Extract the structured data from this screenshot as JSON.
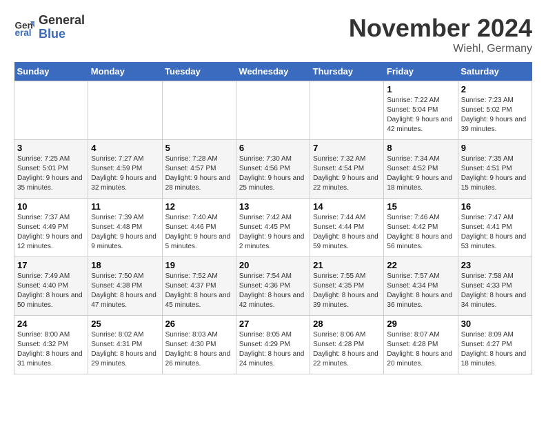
{
  "logo": {
    "general": "General",
    "blue": "Blue"
  },
  "title": {
    "month": "November 2024",
    "location": "Wiehl, Germany"
  },
  "days_of_week": [
    "Sunday",
    "Monday",
    "Tuesday",
    "Wednesday",
    "Thursday",
    "Friday",
    "Saturday"
  ],
  "weeks": [
    [
      {
        "day": "",
        "info": ""
      },
      {
        "day": "",
        "info": ""
      },
      {
        "day": "",
        "info": ""
      },
      {
        "day": "",
        "info": ""
      },
      {
        "day": "",
        "info": ""
      },
      {
        "day": "1",
        "info": "Sunrise: 7:22 AM\nSunset: 5:04 PM\nDaylight: 9 hours and 42 minutes."
      },
      {
        "day": "2",
        "info": "Sunrise: 7:23 AM\nSunset: 5:02 PM\nDaylight: 9 hours and 39 minutes."
      }
    ],
    [
      {
        "day": "3",
        "info": "Sunrise: 7:25 AM\nSunset: 5:01 PM\nDaylight: 9 hours and 35 minutes."
      },
      {
        "day": "4",
        "info": "Sunrise: 7:27 AM\nSunset: 4:59 PM\nDaylight: 9 hours and 32 minutes."
      },
      {
        "day": "5",
        "info": "Sunrise: 7:28 AM\nSunset: 4:57 PM\nDaylight: 9 hours and 28 minutes."
      },
      {
        "day": "6",
        "info": "Sunrise: 7:30 AM\nSunset: 4:56 PM\nDaylight: 9 hours and 25 minutes."
      },
      {
        "day": "7",
        "info": "Sunrise: 7:32 AM\nSunset: 4:54 PM\nDaylight: 9 hours and 22 minutes."
      },
      {
        "day": "8",
        "info": "Sunrise: 7:34 AM\nSunset: 4:52 PM\nDaylight: 9 hours and 18 minutes."
      },
      {
        "day": "9",
        "info": "Sunrise: 7:35 AM\nSunset: 4:51 PM\nDaylight: 9 hours and 15 minutes."
      }
    ],
    [
      {
        "day": "10",
        "info": "Sunrise: 7:37 AM\nSunset: 4:49 PM\nDaylight: 9 hours and 12 minutes."
      },
      {
        "day": "11",
        "info": "Sunrise: 7:39 AM\nSunset: 4:48 PM\nDaylight: 9 hours and 9 minutes."
      },
      {
        "day": "12",
        "info": "Sunrise: 7:40 AM\nSunset: 4:46 PM\nDaylight: 9 hours and 5 minutes."
      },
      {
        "day": "13",
        "info": "Sunrise: 7:42 AM\nSunset: 4:45 PM\nDaylight: 9 hours and 2 minutes."
      },
      {
        "day": "14",
        "info": "Sunrise: 7:44 AM\nSunset: 4:44 PM\nDaylight: 8 hours and 59 minutes."
      },
      {
        "day": "15",
        "info": "Sunrise: 7:46 AM\nSunset: 4:42 PM\nDaylight: 8 hours and 56 minutes."
      },
      {
        "day": "16",
        "info": "Sunrise: 7:47 AM\nSunset: 4:41 PM\nDaylight: 8 hours and 53 minutes."
      }
    ],
    [
      {
        "day": "17",
        "info": "Sunrise: 7:49 AM\nSunset: 4:40 PM\nDaylight: 8 hours and 50 minutes."
      },
      {
        "day": "18",
        "info": "Sunrise: 7:50 AM\nSunset: 4:38 PM\nDaylight: 8 hours and 47 minutes."
      },
      {
        "day": "19",
        "info": "Sunrise: 7:52 AM\nSunset: 4:37 PM\nDaylight: 8 hours and 45 minutes."
      },
      {
        "day": "20",
        "info": "Sunrise: 7:54 AM\nSunset: 4:36 PM\nDaylight: 8 hours and 42 minutes."
      },
      {
        "day": "21",
        "info": "Sunrise: 7:55 AM\nSunset: 4:35 PM\nDaylight: 8 hours and 39 minutes."
      },
      {
        "day": "22",
        "info": "Sunrise: 7:57 AM\nSunset: 4:34 PM\nDaylight: 8 hours and 36 minutes."
      },
      {
        "day": "23",
        "info": "Sunrise: 7:58 AM\nSunset: 4:33 PM\nDaylight: 8 hours and 34 minutes."
      }
    ],
    [
      {
        "day": "24",
        "info": "Sunrise: 8:00 AM\nSunset: 4:32 PM\nDaylight: 8 hours and 31 minutes."
      },
      {
        "day": "25",
        "info": "Sunrise: 8:02 AM\nSunset: 4:31 PM\nDaylight: 8 hours and 29 minutes."
      },
      {
        "day": "26",
        "info": "Sunrise: 8:03 AM\nSunset: 4:30 PM\nDaylight: 8 hours and 26 minutes."
      },
      {
        "day": "27",
        "info": "Sunrise: 8:05 AM\nSunset: 4:29 PM\nDaylight: 8 hours and 24 minutes."
      },
      {
        "day": "28",
        "info": "Sunrise: 8:06 AM\nSunset: 4:28 PM\nDaylight: 8 hours and 22 minutes."
      },
      {
        "day": "29",
        "info": "Sunrise: 8:07 AM\nSunset: 4:28 PM\nDaylight: 8 hours and 20 minutes."
      },
      {
        "day": "30",
        "info": "Sunrise: 8:09 AM\nSunset: 4:27 PM\nDaylight: 8 hours and 18 minutes."
      }
    ]
  ]
}
